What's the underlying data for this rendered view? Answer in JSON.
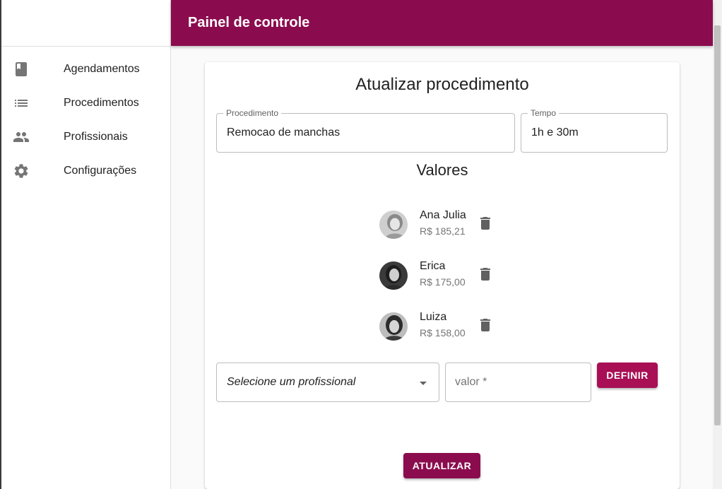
{
  "appbar": {
    "title": "Painel de controle"
  },
  "sidebar": {
    "items": [
      {
        "label": "Agendamentos",
        "icon": "book-icon"
      },
      {
        "label": "Procedimentos",
        "icon": "list-icon"
      },
      {
        "label": "Profissionais",
        "icon": "people-icon"
      },
      {
        "label": "Configurações",
        "icon": "gear-icon"
      }
    ]
  },
  "form": {
    "title": "Atualizar procedimento",
    "procedimento": {
      "label": "Procedimento",
      "value": "Remocao de manchas"
    },
    "tempo": {
      "label": "Tempo",
      "value": "1h e 30m"
    },
    "valores_title": "Valores",
    "professionals": [
      {
        "name": "Ana Julia",
        "value": "R$ 185,21"
      },
      {
        "name": "Erica",
        "value": "R$ 175,00"
      },
      {
        "name": "Luiza",
        "value": "R$ 158,00"
      }
    ],
    "select_placeholder": "Selecione um profissional",
    "valor_placeholder": "valor *",
    "definir_label": "DEFINIR",
    "atualizar_label": "ATUALIZAR"
  },
  "colors": {
    "primary": "#8b0c4e",
    "accent": "#a80f55"
  }
}
